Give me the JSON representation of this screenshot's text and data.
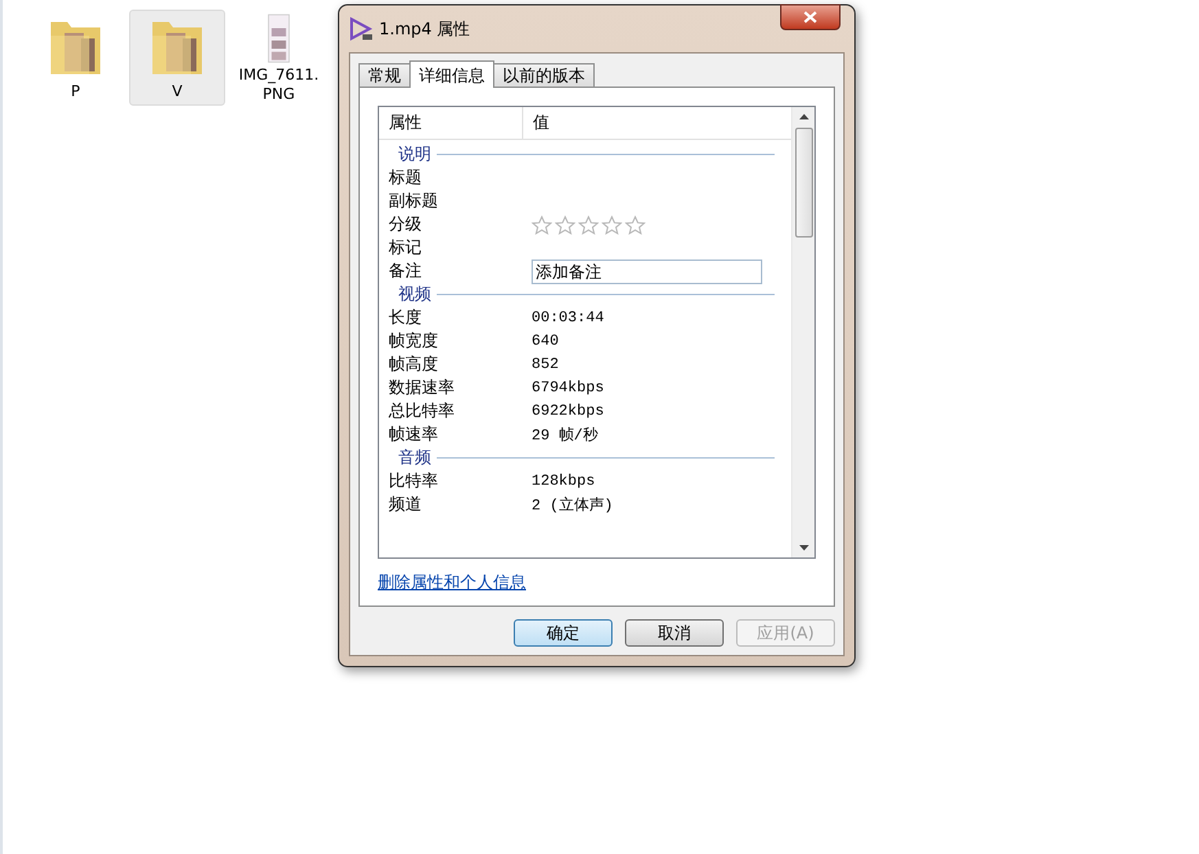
{
  "desktop_icons": [
    {
      "label": "P",
      "kind": "folder",
      "selected": false
    },
    {
      "label": "V",
      "kind": "folder",
      "selected": true
    },
    {
      "label": "IMG_7611.\nPNG",
      "kind": "image",
      "selected": false
    }
  ],
  "window": {
    "title": "1.mp4 属性"
  },
  "tabs": [
    {
      "label": "常规",
      "selected": false
    },
    {
      "label": "详细信息",
      "selected": true
    },
    {
      "label": "以前的版本",
      "selected": false
    }
  ],
  "table": {
    "columns": [
      "属性",
      "值"
    ],
    "rows": [
      {
        "kind": "section",
        "label": "说明"
      },
      {
        "kind": "field",
        "label": "标题"
      },
      {
        "kind": "field",
        "label": "副标题"
      },
      {
        "kind": "stars",
        "label": "分级",
        "stars": 0
      },
      {
        "kind": "field",
        "label": "标记"
      },
      {
        "kind": "input",
        "label": "备注",
        "placeholder": "添加备注"
      },
      {
        "kind": "section",
        "label": "视频"
      },
      {
        "kind": "field",
        "label": "长度",
        "value": "00:03:44"
      },
      {
        "kind": "field",
        "label": "帧宽度",
        "value": "640"
      },
      {
        "kind": "field",
        "label": "帧高度",
        "value": "852"
      },
      {
        "kind": "field",
        "label": "数据速率",
        "value": "6794kbps"
      },
      {
        "kind": "field",
        "label": "总比特率",
        "value": "6922kbps"
      },
      {
        "kind": "field",
        "label": "帧速率",
        "value": "29 帧/秒"
      },
      {
        "kind": "section",
        "label": "音频"
      },
      {
        "kind": "field",
        "label": "比特率",
        "value": "128kbps"
      },
      {
        "kind": "field",
        "label": "频道",
        "value": "2 (立体声)"
      }
    ]
  },
  "link": "删除属性和个人信息",
  "buttons": [
    {
      "label": "确定",
      "kind": "default",
      "disabled": false
    },
    {
      "label": "取消",
      "kind": "normal",
      "disabled": false
    },
    {
      "label": "应用(A)",
      "kind": "normal",
      "disabled": true
    }
  ]
}
